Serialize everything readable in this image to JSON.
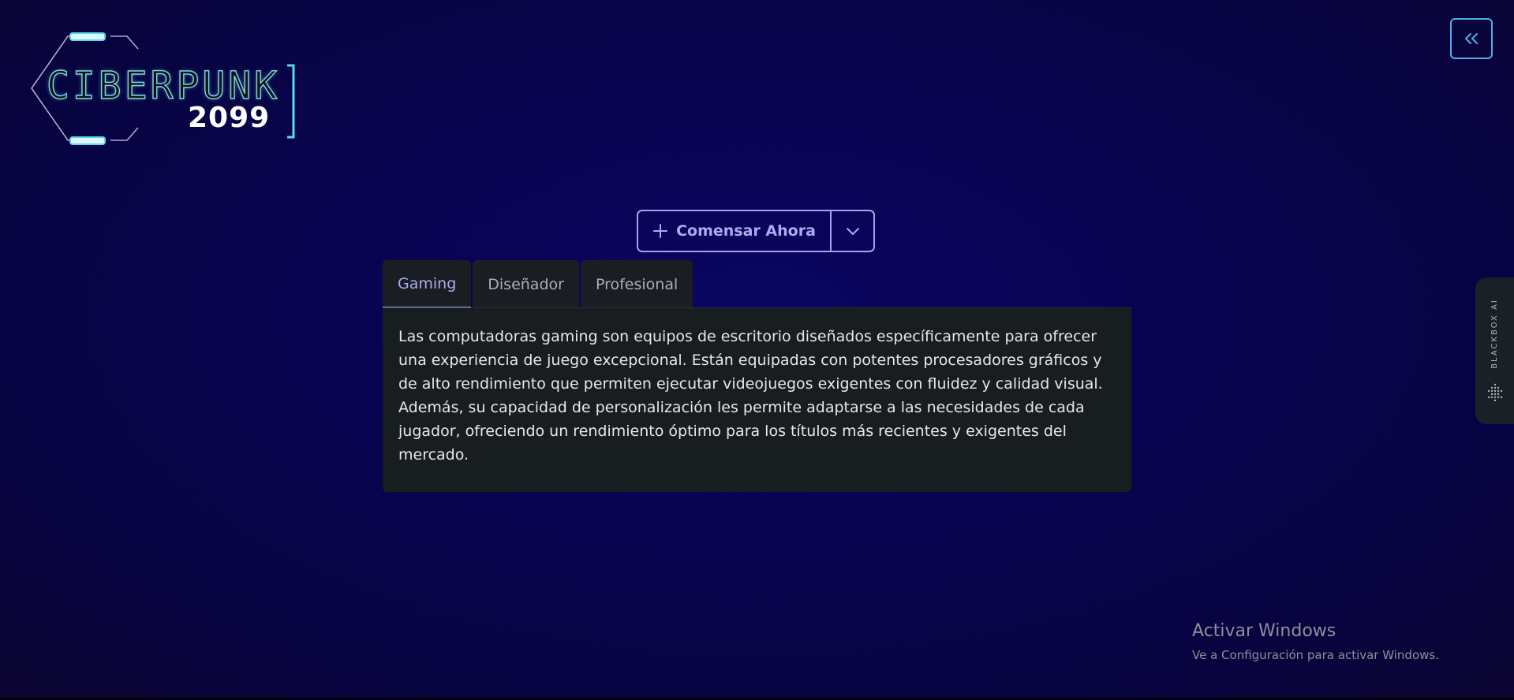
{
  "logo": {
    "text": "CIBERPUNK",
    "year": "2099"
  },
  "header": {
    "collapse_icon": "double-chevron-left-icon"
  },
  "cta": {
    "label": "Comensar Ahora",
    "plus_icon": "plus-icon",
    "dropdown_icon": "chevron-down-icon"
  },
  "tabs": [
    {
      "label": "Gaming",
      "active": true
    },
    {
      "label": "Diseñador",
      "active": false
    },
    {
      "label": "Profesional",
      "active": false
    }
  ],
  "panel": {
    "text": "Las computadoras gaming son equipos de escritorio diseñados específicamente para ofrecer una experiencia de juego excepcional. Están equipadas con potentes procesadores gráficos y de alto rendimiento que permiten ejecutar videojuegos exigentes con fluidez y calidad visual. Además, su capacidad de personalización les permite adaptarse a las necesidades de cada jugador, ofreciendo un rendimiento óptimo para los títulos más recientes y exigentes del mercado."
  },
  "blackbox": {
    "label": "BLACKBOX AI",
    "icon": "dot-grid-icon"
  },
  "watermark": {
    "title": "Activar Windows",
    "subtitle": "Ve a Configuración para activar Windows."
  },
  "colors": {
    "background": "#08044f",
    "accent": "#a6a2f2",
    "panel": "#181d20",
    "cyan": "#7ad6e8"
  }
}
